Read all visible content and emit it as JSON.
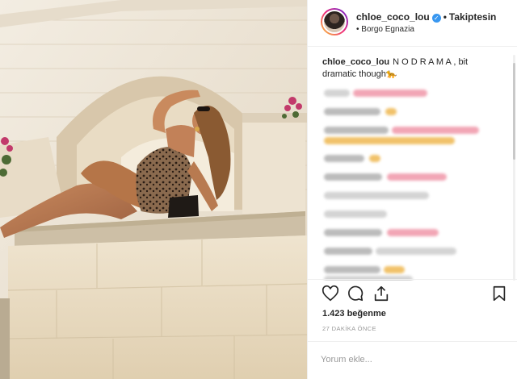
{
  "header": {
    "username": "chloe_coco_lou",
    "verified_icon": "verified-badge-icon",
    "separator": "•",
    "follow_label": "Takiptesin",
    "location_bullet": "•",
    "location": "Borgo Egnazia"
  },
  "caption": {
    "username": "chloe_coco_lou",
    "text": "N O D R A M A , bit dramatic though🐆"
  },
  "actions": {
    "like_icon": "heart-icon",
    "comment_icon": "comment-icon",
    "share_icon": "share-icon",
    "save_icon": "bookmark-icon",
    "likes": "1.423 beğenme",
    "time": "27 DAKİKA ÖNCE"
  },
  "add_comment": {
    "placeholder": "Yorum ekle..."
  },
  "colors": {
    "verified": "#3897f0",
    "text": "#262626",
    "muted": "#999999",
    "border": "#efefef"
  }
}
